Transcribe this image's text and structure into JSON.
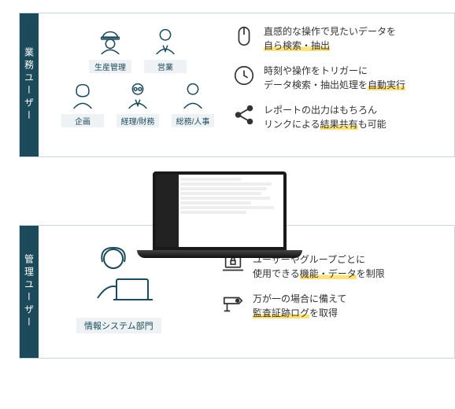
{
  "labels": {
    "topSection": "業務ユーザー",
    "bottomSection": "管理ユーザー"
  },
  "roles": {
    "row1": [
      {
        "id": "production",
        "label": "生産管理"
      },
      {
        "id": "sales",
        "label": "営業"
      }
    ],
    "row2": [
      {
        "id": "planning",
        "label": "企画"
      },
      {
        "id": "finance",
        "label": "経理/財務"
      },
      {
        "id": "hr",
        "label": "総務/人事"
      }
    ]
  },
  "topFeatures": [
    {
      "icon": "mouse",
      "pre": "直感的な操作で見たいデータを",
      "hl": "自ら検索・抽出"
    },
    {
      "icon": "clock",
      "pre": "時刻や操作をトリガーに\nデータ検索・抽出処理を",
      "hl": "自動実行"
    },
    {
      "icon": "share",
      "pre": "レポートの出力はもちろん\nリンクによる",
      "hl": "結果共有",
      "post": "も可能"
    }
  ],
  "adminRole": {
    "label": "情報システム部門"
  },
  "bottomFeatures": [
    {
      "icon": "laptop-lock",
      "pre": "ユーザーやグループごとに\n使用できる",
      "hl": "機能・データ",
      "post": "を制限"
    },
    {
      "icon": "camera",
      "pre": "万が一の場合に備えて",
      "hl": "監査証跡ログ",
      "post": "を取得"
    }
  ],
  "colors": {
    "primary": "#1d4a5a",
    "highlight": "#ffe27a"
  }
}
